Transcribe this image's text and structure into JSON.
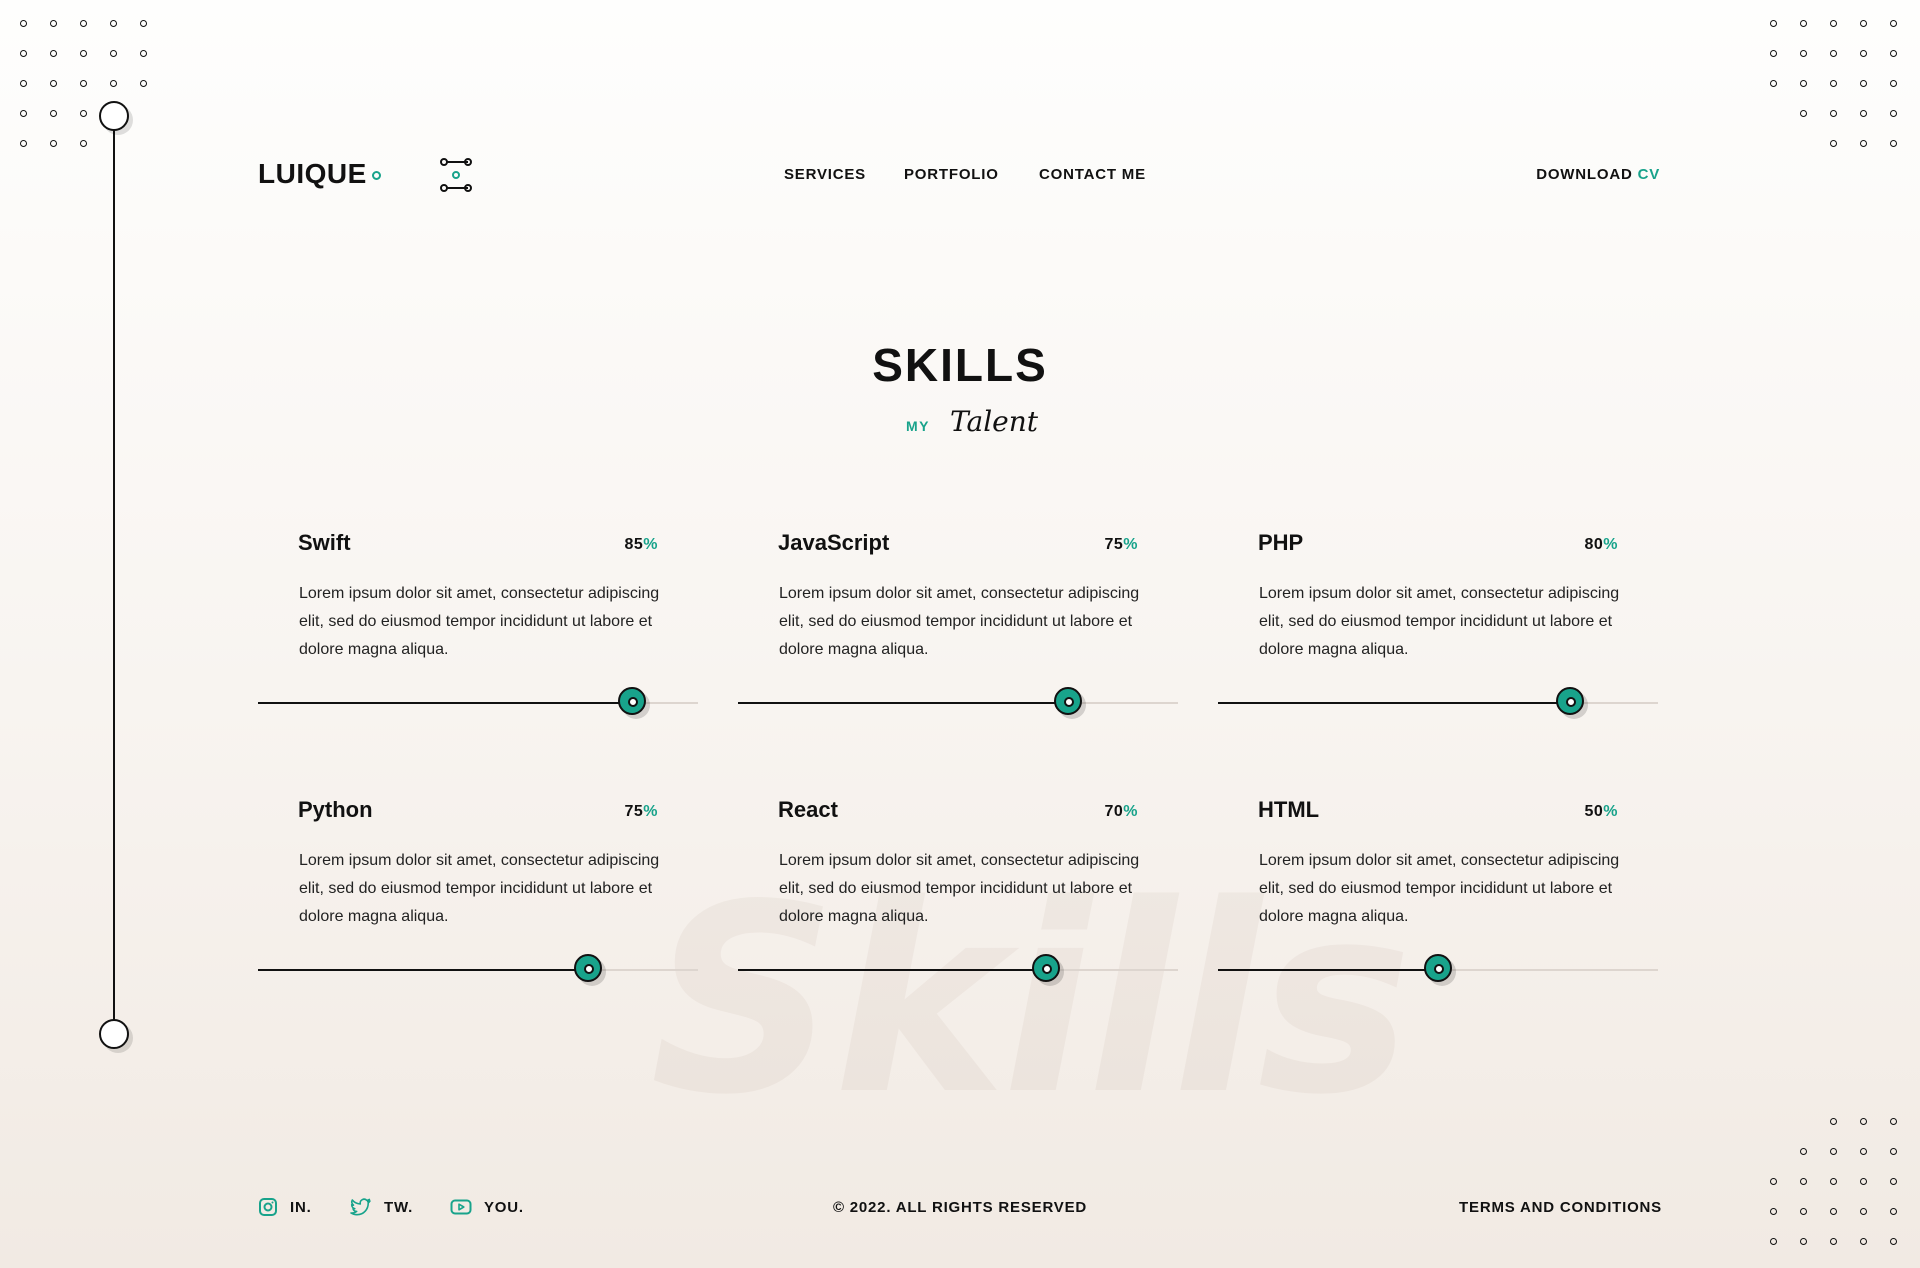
{
  "header": {
    "logo": "LUIQUE",
    "nav": [
      {
        "label": "SERVICES"
      },
      {
        "label": "PORTFOLIO"
      },
      {
        "label": "CONTACT ME"
      }
    ],
    "download_label": "DOWNLOAD",
    "download_accent": "CV"
  },
  "section": {
    "title": "SKILLS",
    "subtitle_small": "MY",
    "subtitle_script": "Talent",
    "watermark": "Skills"
  },
  "skills": [
    {
      "name": "Swift",
      "percent": "85",
      "percent_sign": "%",
      "level": 0.85,
      "description": "Lorem ipsum dolor sit amet, consectetur adipiscing elit, sed do eiusmod tempor incididunt ut labore et dolore magna aliqua."
    },
    {
      "name": "JavaScript",
      "percent": "75",
      "percent_sign": "%",
      "level": 0.75,
      "description": "Lorem ipsum dolor sit amet, consectetur adipiscing elit, sed do eiusmod tempor incididunt ut labore et dolore magna aliqua."
    },
    {
      "name": "PHP",
      "percent": "80",
      "percent_sign": "%",
      "level": 0.8,
      "description": "Lorem ipsum dolor sit amet, consectetur adipiscing elit, sed do eiusmod tempor incididunt ut labore et dolore magna aliqua."
    },
    {
      "name": "Python",
      "percent": "75",
      "percent_sign": "%",
      "level": 0.75,
      "description": "Lorem ipsum dolor sit amet, consectetur adipiscing elit, sed do eiusmod tempor incididunt ut labore et dolore magna aliqua."
    },
    {
      "name": "React",
      "percent": "70",
      "percent_sign": "%",
      "level": 0.7,
      "description": "Lorem ipsum dolor sit amet, consectetur adipiscing elit, sed do eiusmod tempor incididunt ut labore et dolore magna aliqua."
    },
    {
      "name": "HTML",
      "percent": "50",
      "percent_sign": "%",
      "level": 0.5,
      "description": "Lorem ipsum dolor sit amet, consectetur adipiscing elit, sed do eiusmod tempor incididunt ut labore et dolore magna aliqua."
    }
  ],
  "footer": {
    "social": [
      {
        "label": "IN.",
        "icon": "instagram-icon"
      },
      {
        "label": "TW.",
        "icon": "twitter-icon"
      },
      {
        "label": "YOU.",
        "icon": "youtube-icon"
      }
    ],
    "copyright": "© 2022. ALL RIGHTS RESERVED",
    "terms": "TERMS AND CONDITIONS"
  },
  "colors": {
    "accent": "#18a38b",
    "text": "#111111",
    "track": "#ddd5cf"
  }
}
